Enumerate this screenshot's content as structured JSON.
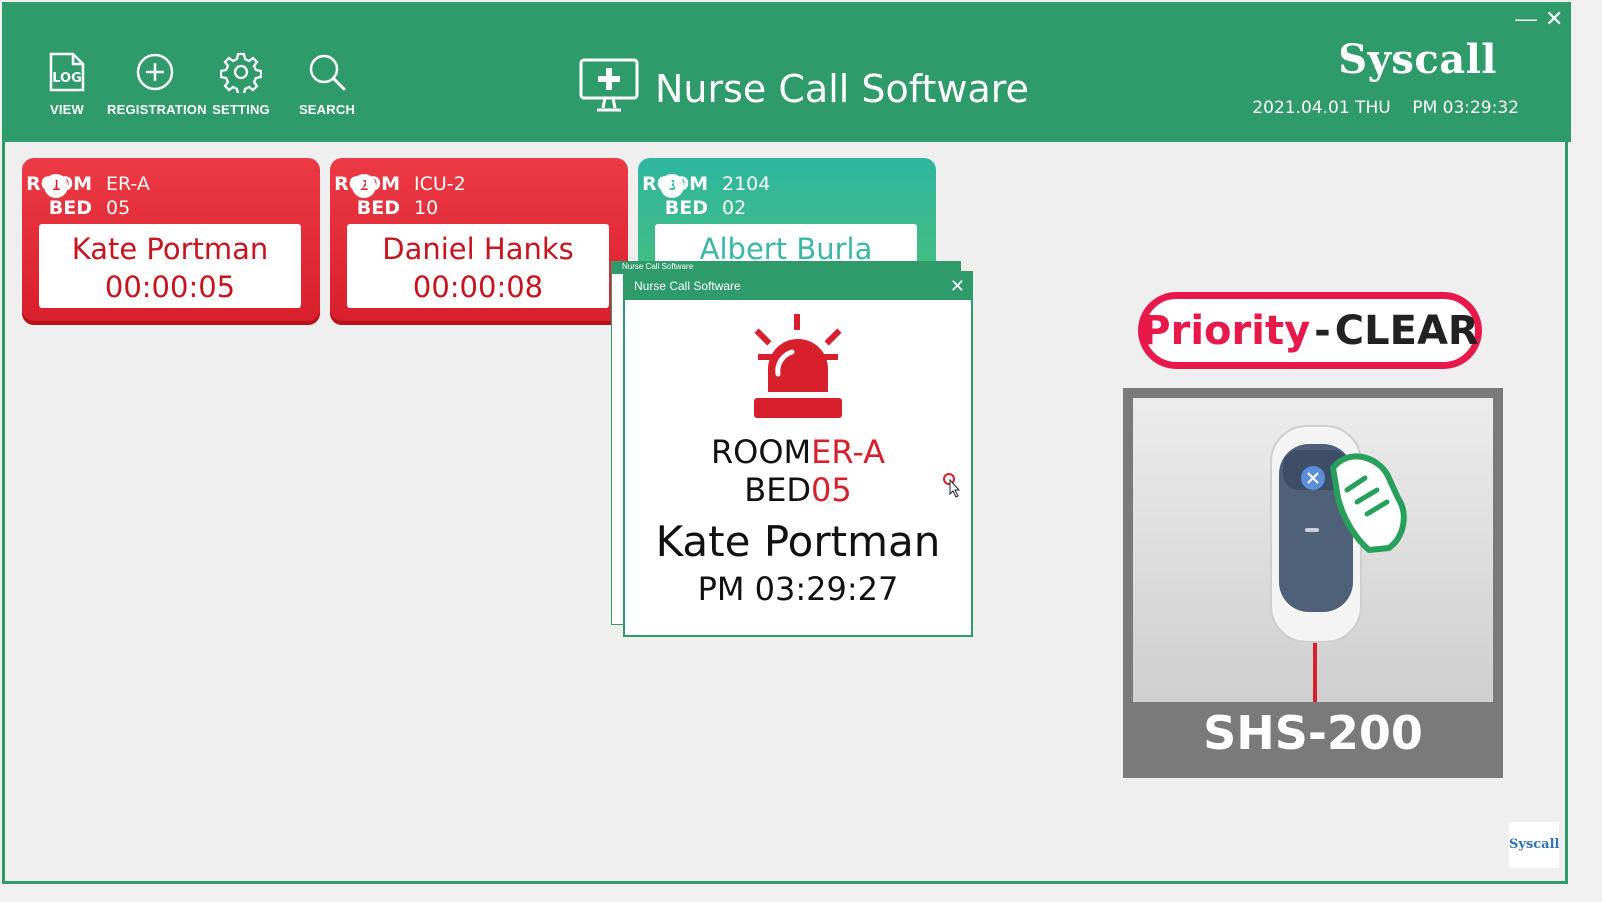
{
  "window": {
    "minimize": "—",
    "close": "✕"
  },
  "toolbar": [
    {
      "label": "VIEW",
      "icon": "log-file-icon",
      "icon_text": "LOG"
    },
    {
      "label": "REGISTRATION",
      "icon": "plus-circle-icon"
    },
    {
      "label": "SETTING",
      "icon": "gear-icon"
    },
    {
      "label": "SEARCH",
      "icon": "search-icon"
    }
  ],
  "header": {
    "title": "Nurse Call Software",
    "brand": "Syscall",
    "date": "2021.04.01 THU",
    "time": "PM 03:29:32"
  },
  "calls": [
    {
      "num": "1",
      "room_key": "ROOM",
      "room": "ER-A",
      "bed_key": "BED",
      "bed": "05",
      "name": "Kate Portman",
      "elapsed": "00:00:05",
      "status": "active"
    },
    {
      "num": "2",
      "room_key": "ROOM",
      "room": "ICU-2",
      "bed_key": "BED",
      "bed": "10",
      "name": "Daniel Hanks",
      "elapsed": "00:00:08",
      "status": "active"
    },
    {
      "num": "3",
      "room_key": "ROOM",
      "room": "2104",
      "bed_key": "BED",
      "bed": "02",
      "name": "Albert Burla",
      "elapsed": "",
      "status": "normal"
    }
  ],
  "popup": {
    "window_title": "Nurse Call Software",
    "back_title": "Nurse Call Software",
    "close": "✕",
    "room_key": "ROOM",
    "room": "ER-A",
    "bed_key": "BED",
    "bed": "05",
    "name": "Kate Portman",
    "time": "PM 03:29:27"
  },
  "priority": {
    "word": "Priority",
    "dash": "-",
    "status": "CLEAR"
  },
  "device": {
    "model": "SHS-200"
  },
  "footer": {
    "brand": "Syscall"
  },
  "colors": {
    "header": "#2f9a6a",
    "alert_red": "#d81f2c",
    "priority_pink": "#e8194a",
    "normal_green": "#2fb6a0"
  }
}
